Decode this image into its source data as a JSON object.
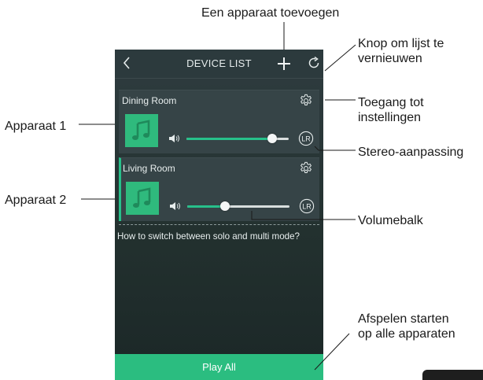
{
  "header": {
    "title": "DEVICE LIST"
  },
  "devices": [
    {
      "name": "Dining Room",
      "volume": 0.84,
      "selected": false
    },
    {
      "name": "Living Room",
      "volume": 0.37,
      "selected": true
    }
  ],
  "stereo_label": "LR",
  "question": "How to switch between solo and multi mode?",
  "play_all_label": "Play All",
  "annotations": {
    "add_device": "Een apparaat toevoegen",
    "refresh_line1": "Knop om lijst te",
    "refresh_line2": "vernieuwen",
    "settings_line1": "Toegang tot",
    "settings_line2": "instellingen",
    "stereo": "Stereo-aanpassing",
    "device1": "Apparaat 1",
    "device2": "Apparaat 2",
    "volume_bar": "Volumebalk",
    "play_all_line1": "Afspelen starten",
    "play_all_line2": "op alle apparaten"
  },
  "colors": {
    "accent": "#2bbd80",
    "screen_bg": "#2f3c40",
    "card_bg": "#364447"
  },
  "icons": {
    "back": "chevron-left-icon",
    "add": "plus-icon",
    "refresh": "refresh-icon",
    "settings": "gear-icon",
    "album": "music-note-icon",
    "speaker": "speaker-icon",
    "stereo": "lr-icon"
  }
}
